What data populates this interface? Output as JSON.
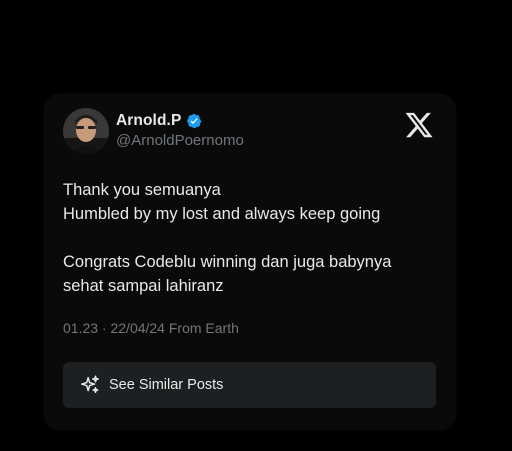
{
  "post": {
    "display_name": "Arnold.P",
    "handle": "@ArnoldPoernomo",
    "verified": true,
    "lines_para1": [
      "Thank you semuanya",
      "Humbled by my lost and always keep going"
    ],
    "lines_para2": [
      "Congrats Codeblu winning dan juga babynya",
      "sehat sampai lahiranz"
    ],
    "meta": "01.23 · 22/04/24 From Earth",
    "see_similar_label": "See Similar Posts"
  },
  "icons": {
    "brand": "x-logo-icon",
    "verified": "verified-badge-icon",
    "similar": "sparkle-icon"
  },
  "colors": {
    "background": "#000000",
    "card": "#0a0a0a",
    "text_primary": "#e7e9ea",
    "text_secondary": "#71767b",
    "verified_blue": "#1d9bf0",
    "button_bg": "#1e1f21"
  }
}
